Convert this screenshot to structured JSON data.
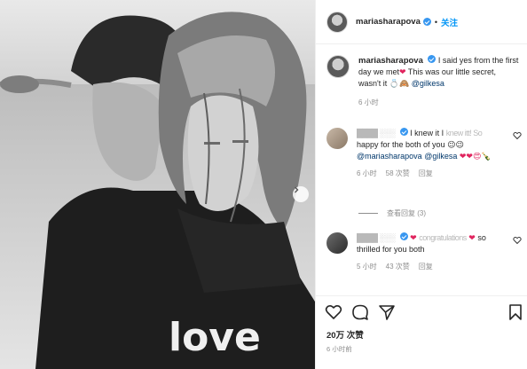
{
  "header": {
    "username": "mariasharapova",
    "separator": "•",
    "follow": "关注"
  },
  "caption": {
    "username": "mariasharapova",
    "text_1": "I said yes from the first day we met",
    "heart": "❤",
    "text_2": "This was our little secret, wasn't it",
    "emojis": "💍🙈",
    "mention": "@gilkesa",
    "time": "6 小时"
  },
  "comments": [
    {
      "blurred_name": "████ ░░░",
      "text_1": "I knew it I",
      "blurred_text": "knew itt! So",
      "text_2": "happy for the both of you",
      "emojis_1": "😉😉",
      "mention_1": "@mariasharapova",
      "mention_2": "@gilkesa",
      "emojis_2": "❤❤😍🍾",
      "time": "6 小时",
      "likes": "58 次赞",
      "reply": "回复"
    },
    {
      "blurred_name": "████ ░░░",
      "heart_after_name": "❤",
      "blurred_text": "congratulations",
      "heart": "❤",
      "text": "so thrilled for you both",
      "time": "5 小时",
      "likes": "43 次赞",
      "reply": "回复"
    }
  ],
  "view_replies": "查看回复 (3)",
  "likes": "20万 次赞",
  "post_time": "6 小时前",
  "photo": {
    "shirt_text": "love"
  },
  "colors": {
    "accent": "#0095f6",
    "verified": "#3897f0",
    "heart": "#e0245e",
    "muted": "#8e8e8e"
  }
}
